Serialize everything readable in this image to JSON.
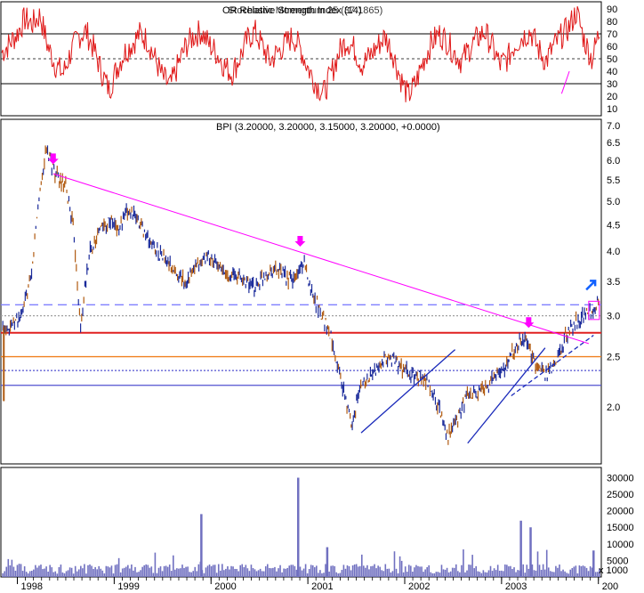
{
  "colors": {
    "background": "#ffffff",
    "rsi_line": "#e01818",
    "price_up": "#1a2a9a",
    "price_down": "#b05a10",
    "volume": "#7070c0",
    "magenta": "#ff00ff",
    "red_line": "#e02020",
    "orange_line": "#f08020",
    "blue_line": "#5050d0",
    "dashed_line": "#8080ff",
    "trend_line": "#1a2aba"
  },
  "rsi_panel": {
    "title_overlap_a": "OR Relative Strength Index (14)",
    "title_overlap_b": "Stochastic Momentum 25 (37.1865)",
    "levels": [
      10,
      20,
      30,
      40,
      50,
      60,
      70,
      80,
      90
    ]
  },
  "price_panel": {
    "title": "BPI (3.20000, 3.20000, 3.15000, 3.20000, +0.0000)",
    "levels": [
      "2.0",
      "2.5",
      "3.0",
      "3.5",
      "4.0",
      "4.5",
      "5.0",
      "5.5",
      "6.0",
      "6.5",
      "7.0"
    ]
  },
  "volume_panel": {
    "levels": [
      "5000",
      "10000",
      "15000",
      "20000",
      "25000",
      "30000"
    ],
    "unit": "x 1000"
  },
  "x_axis": {
    "labels": [
      "1998",
      "1999",
      "2000",
      "2001",
      "2002",
      "2003",
      "200"
    ]
  },
  "chart_data": [
    {
      "type": "line",
      "panel": "indicator",
      "ylim": [
        5,
        95
      ],
      "reference_lines": [
        30,
        50,
        70
      ],
      "series": [
        {
          "values": [
            55,
            62,
            70,
            82,
            78,
            85,
            60,
            45,
            38,
            55,
            68,
            72,
            58,
            40,
            25,
            42,
            55,
            62,
            70,
            65,
            50,
            35,
            28,
            45,
            60,
            68,
            72,
            62,
            55,
            45,
            38,
            50,
            65,
            72,
            60,
            48,
            55,
            62,
            68,
            58,
            42,
            30,
            22,
            38,
            55,
            65,
            58,
            45,
            52,
            60,
            68,
            55,
            35,
            20,
            30,
            48,
            62,
            70,
            65,
            55,
            48,
            58,
            66,
            72,
            60,
            45,
            50,
            62,
            68,
            72,
            58,
            48,
            60,
            68,
            75,
            88,
            65,
            50,
            72
          ]
        }
      ]
    },
    {
      "type": "line",
      "panel": "price",
      "title": "BPI (3.20000, 3.20000, 3.15000, 3.20000, +0.0000)",
      "ylim": [
        1.55,
        7.2
      ],
      "scale": "log",
      "x": [
        "1997.85",
        "1997.95",
        "1998.05",
        "1998.15",
        "1998.22",
        "1998.30",
        "1998.40",
        "1998.50",
        "1998.58",
        "1998.65",
        "1998.75",
        "1998.85",
        "1998.95",
        "1999.05",
        "1999.15",
        "1999.25",
        "1999.35",
        "1999.45",
        "1999.55",
        "1999.65",
        "1999.75",
        "1999.85",
        "1999.95",
        "2000.05",
        "2000.15",
        "2000.25",
        "2000.35",
        "2000.45",
        "2000.55",
        "2000.65",
        "2000.75",
        "2000.85",
        "2000.95",
        "2001.05",
        "2001.15",
        "2001.25",
        "2001.35",
        "2001.45",
        "2001.55",
        "2001.65",
        "2001.75",
        "2001.85",
        "2001.95",
        "2002.05",
        "2002.15",
        "2002.25",
        "2002.35",
        "2002.45",
        "2002.55",
        "2002.65",
        "2002.75",
        "2002.85",
        "2002.95",
        "2003.05",
        "2003.15",
        "2003.25",
        "2003.35",
        "2003.45",
        "2003.55",
        "2003.65",
        "2003.75",
        "2003.85",
        "2003.95",
        "2004.00"
      ],
      "series": [
        {
          "name": "BPI",
          "values": [
            2.85,
            2.9,
            3.0,
            3.6,
            5.0,
            6.3,
            5.6,
            5.3,
            4.4,
            2.8,
            4.0,
            4.4,
            4.6,
            4.4,
            4.8,
            4.6,
            4.2,
            4.0,
            3.8,
            3.6,
            3.5,
            3.7,
            3.9,
            3.8,
            3.6,
            3.6,
            3.5,
            3.4,
            3.6,
            3.7,
            3.6,
            3.5,
            3.8,
            3.3,
            3.0,
            2.7,
            2.2,
            1.85,
            2.2,
            2.3,
            2.4,
            2.5,
            2.4,
            2.3,
            2.3,
            2.2,
            2.0,
            1.75,
            1.9,
            2.1,
            2.1,
            2.2,
            2.3,
            2.4,
            2.6,
            2.75,
            2.4,
            2.3,
            2.4,
            2.7,
            2.9,
            3.0,
            3.1,
            3.2
          ]
        }
      ],
      "horizontal_lines": [
        {
          "value": 2.78,
          "style": "solid",
          "color": "red"
        },
        {
          "value": 2.5,
          "style": "solid",
          "color": "orange"
        },
        {
          "value": 2.35,
          "style": "dotted",
          "color": "blue"
        },
        {
          "value": 2.2,
          "style": "solid",
          "color": "blue"
        },
        {
          "value": 3.15,
          "style": "dashed",
          "color": "blue"
        },
        {
          "value": 3.0,
          "style": "dotted",
          "color": "gray"
        }
      ]
    },
    {
      "type": "bar",
      "panel": "volume",
      "ylim": [
        0,
        32000
      ],
      "peaks": [
        {
          "x": "1999.90",
          "value": 19000
        },
        {
          "x": "2000.90",
          "value": 30000
        },
        {
          "x": "2001.20",
          "value": 9000
        },
        {
          "x": "2003.20",
          "value": 17000
        },
        {
          "x": "2003.30",
          "value": 15000
        },
        {
          "x": "2003.95",
          "value": 8000
        }
      ],
      "baseline_level": 2500
    }
  ]
}
